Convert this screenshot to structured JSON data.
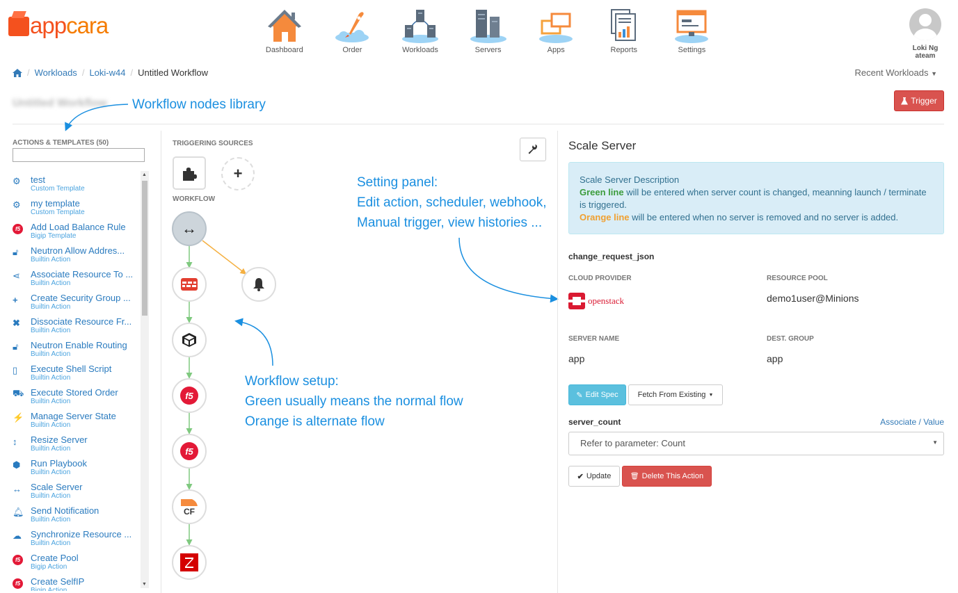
{
  "brand": {
    "part1": "app",
    "part2": "cara"
  },
  "nav": [
    {
      "label": "Dashboard",
      "icon": "house-icon"
    },
    {
      "label": "Order",
      "icon": "rocket-icon"
    },
    {
      "label": "Workloads",
      "icon": "workloads-icon"
    },
    {
      "label": "Servers",
      "icon": "servers-icon"
    },
    {
      "label": "Apps",
      "icon": "apps-icon"
    },
    {
      "label": "Reports",
      "icon": "reports-icon"
    },
    {
      "label": "Settings",
      "icon": "settings-icon"
    }
  ],
  "user": {
    "name": "Loki Ng",
    "team": "ateam"
  },
  "breadcrumb": [
    "Workloads",
    "Loki-w44",
    "Untitled Workflow"
  ],
  "recent_workloads": "Recent Workloads",
  "page_title": "Untitled Workflow",
  "trigger_label": "Trigger",
  "annotations": {
    "library": "Workflow nodes library",
    "setting": [
      "Setting panel:",
      "Edit action, scheduler, webhook,",
      "Manual trigger, view histories ..."
    ],
    "workflow": [
      "Workflow setup:",
      "Green usually means the normal flow",
      "Orange is alternate flow"
    ]
  },
  "library": {
    "title": "ACTIONS & TEMPLATES (50)",
    "items": [
      {
        "name": "test",
        "type": "Custom Template",
        "icon": "gears-icon"
      },
      {
        "name": "my template",
        "type": "Custom Template",
        "icon": "gears-icon"
      },
      {
        "name": "Add Load Balance Rule",
        "type": "Bigip Template",
        "icon": "f5-icon"
      },
      {
        "name": "Neutron Allow Addres...",
        "type": "Builtin Action",
        "icon": "lock-icon"
      },
      {
        "name": "Associate Resource To ...",
        "type": "Builtin Action",
        "icon": "share-icon"
      },
      {
        "name": "Create Security Group ...",
        "type": "Builtin Action",
        "icon": "plus-icon"
      },
      {
        "name": "Dissociate Resource Fr...",
        "type": "Builtin Action",
        "icon": "times-icon"
      },
      {
        "name": "Neutron Enable Routing",
        "type": "Builtin Action",
        "icon": "unlock-icon"
      },
      {
        "name": "Execute Shell Script",
        "type": "Builtin Action",
        "icon": "file-code-icon"
      },
      {
        "name": "Execute Stored Order",
        "type": "Builtin Action",
        "icon": "cart-icon"
      },
      {
        "name": "Manage Server State",
        "type": "Builtin Action",
        "icon": "plug-icon"
      },
      {
        "name": "Resize Server",
        "type": "Builtin Action",
        "icon": "resize-vertical-icon"
      },
      {
        "name": "Run Playbook",
        "type": "Builtin Action",
        "icon": "cube-icon"
      },
      {
        "name": "Scale Server",
        "type": "Builtin Action",
        "icon": "arrows-h-icon"
      },
      {
        "name": "Send Notification",
        "type": "Builtin Action",
        "icon": "bell-icon"
      },
      {
        "name": "Synchronize Resource ...",
        "type": "Builtin Action",
        "icon": "cloud-icon"
      },
      {
        "name": "Create Pool",
        "type": "Bigip Action",
        "icon": "f5-icon"
      },
      {
        "name": "Create SelfIP",
        "type": "Bigip Action",
        "icon": "f5-icon"
      }
    ]
  },
  "workflow": {
    "triggering_label": "TRIGGERING SOURCES",
    "workflow_label": "WORKFLOW"
  },
  "settings": {
    "title": "Scale Server",
    "desc_title": "Scale Server Description",
    "desc_green": "Green line",
    "desc_green_rest": " will be entered when server count is changed, meanning launch / terminate is triggered.",
    "desc_orange": "Orange line",
    "desc_orange_rest": " will be entered when no server is removed and no server is added.",
    "change_request": "change_request_json",
    "cloud_provider_label": "CLOUD PROVIDER",
    "cloud_provider": "openstack",
    "resource_pool_label": "RESOURCE POOL",
    "resource_pool": "demo1user@Minions",
    "server_name_label": "SERVER NAME",
    "server_name": "app",
    "dest_group_label": "DEST. GROUP",
    "dest_group": "app",
    "edit_spec": "Edit Spec",
    "fetch": "Fetch From Existing",
    "server_count_label": "server_count",
    "associate": "Associate",
    "value": "Value",
    "select_value": "Refer to parameter: Count",
    "update": "Update",
    "delete": "Delete This Action"
  },
  "colors": {
    "accent": "#337ab7",
    "green_line": "#7fc97f",
    "orange_line": "#f5b041",
    "danger": "#d9534f",
    "info": "#5bc0de",
    "annotation": "#1a8fe0"
  }
}
